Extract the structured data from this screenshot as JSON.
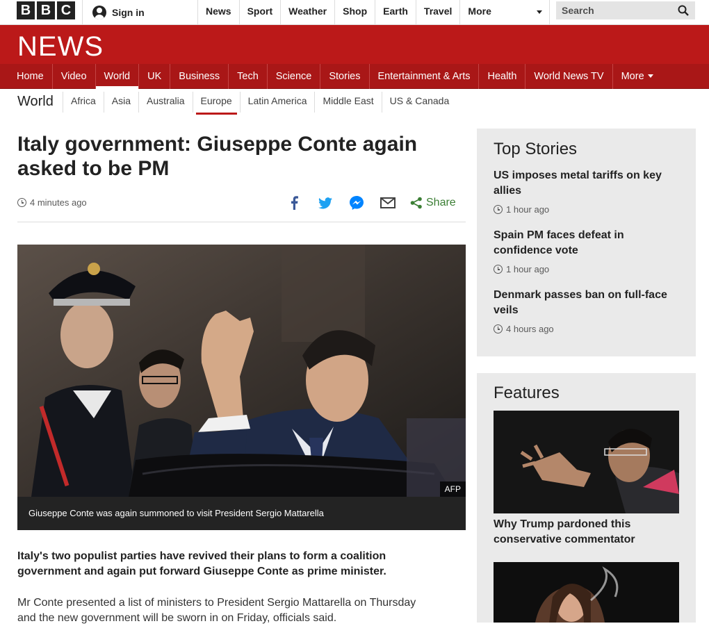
{
  "topbar": {
    "logo_letters": [
      "B",
      "B",
      "C"
    ],
    "signin_label": "Sign in",
    "nav": [
      "News",
      "Sport",
      "Weather",
      "Shop",
      "Earth",
      "Travel"
    ],
    "more_label": "More",
    "search_placeholder": "Search"
  },
  "banner": {
    "logo": "NEWS",
    "color": "#bb1919"
  },
  "mainnav": {
    "items": [
      "Home",
      "Video",
      "World",
      "UK",
      "Business",
      "Tech",
      "Science",
      "Stories",
      "Entertainment & Arts",
      "Health",
      "World News TV",
      "More"
    ],
    "active": "World"
  },
  "secnav": {
    "title": "World",
    "items": [
      "Africa",
      "Asia",
      "Australia",
      "Europe",
      "Latin America",
      "Middle East",
      "US & Canada"
    ],
    "active": "Europe"
  },
  "article": {
    "headline": "Italy government: Giuseppe Conte again asked to be PM",
    "timestamp": "4 minutes ago",
    "share_label": "Share",
    "share_icons": [
      "facebook-icon",
      "twitter-icon",
      "messenger-icon",
      "email-icon",
      "share-icon"
    ],
    "image_credit": "AFP",
    "caption": "Giuseppe Conte was again summoned to visit President Sergio Mattarella",
    "intro": "Italy's two populist parties have revived their plans to form a coalition government and again put forward Giuseppe Conte as prime minister.",
    "body": "Mr Conte presented a list of ministers to President Sergio Mattarella on Thursday and the new government will be sworn in on Friday, officials said."
  },
  "sidebar": {
    "top_stories_title": "Top Stories",
    "top_stories": [
      {
        "title": "US imposes metal tariffs on key allies",
        "time": "1 hour ago"
      },
      {
        "title": "Spain PM faces defeat in confidence vote",
        "time": "1 hour ago"
      },
      {
        "title": "Denmark passes ban on full-face veils",
        "time": "4 hours ago"
      }
    ],
    "features_title": "Features",
    "features": [
      {
        "title": "Why Trump pardoned this conservative commentator"
      }
    ]
  }
}
